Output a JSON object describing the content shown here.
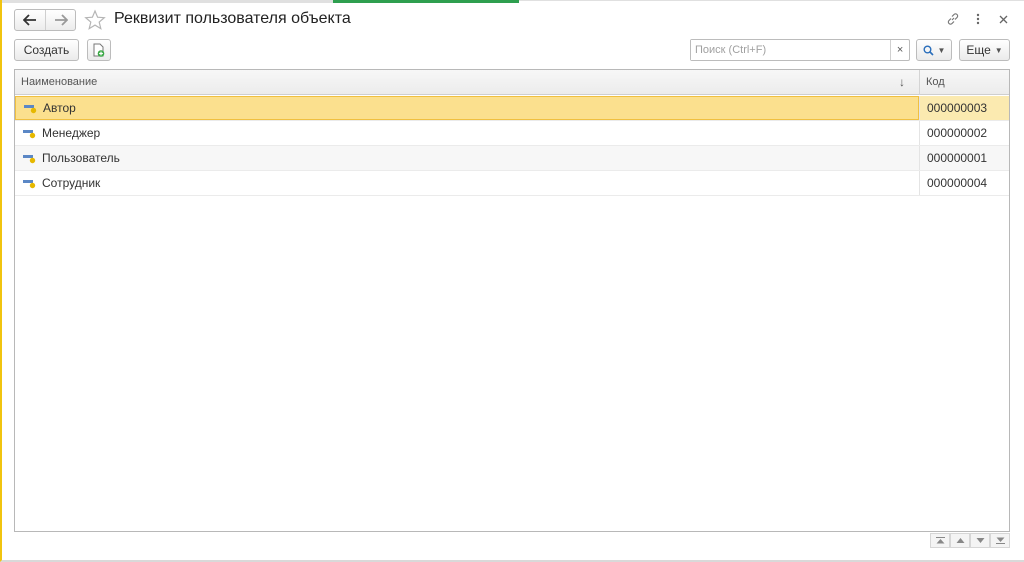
{
  "window": {
    "title": "Реквизит пользователя объекта"
  },
  "toolbar": {
    "create_label": "Создать",
    "search_placeholder": "Поиск (Ctrl+F)",
    "search_clear": "×",
    "more_label": "Еще"
  },
  "table": {
    "columns": [
      {
        "label": "Наименование"
      },
      {
        "label": "Код"
      }
    ],
    "sort_indicator": "↓",
    "rows": [
      {
        "name": "Автор",
        "code": "000000003",
        "selected": true
      },
      {
        "name": "Менеджер",
        "code": "000000002",
        "selected": false
      },
      {
        "name": "Пользователь",
        "code": "000000001",
        "selected": false
      },
      {
        "name": "Сотрудник",
        "code": "000000004",
        "selected": false
      }
    ]
  },
  "colors": {
    "selection": "#fbe08e",
    "accent_green": "#2e9f4f",
    "frame_yellow": "#f1c40f"
  },
  "icons": {
    "back": "arrow-left-icon",
    "forward": "arrow-right-icon",
    "favorite": "star-icon",
    "link": "link-icon",
    "menu": "more-vert-icon",
    "close": "close-icon",
    "copy": "copy-doc-icon",
    "search": "search-icon",
    "attribute": "attribute-icon"
  }
}
